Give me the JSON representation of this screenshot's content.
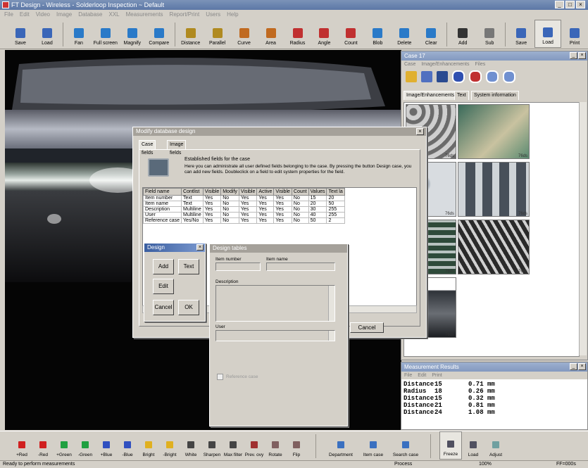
{
  "app": {
    "title": "FT Design - Wireless - Solderloop Inspection ~ Default",
    "menu": [
      "File",
      "Edit",
      "Video",
      "Image",
      "Database",
      "XXL",
      "Measurements",
      "Report/Print",
      "Users",
      "Help"
    ]
  },
  "toolbar": {
    "groups": [
      [
        {
          "label": "Save",
          "color": "#3a66b8"
        },
        {
          "label": "Load",
          "color": "#3a66b8"
        }
      ],
      [
        {
          "label": "Fan",
          "color": "#2a7ac8"
        },
        {
          "label": "Full screen",
          "color": "#2a7ac8"
        },
        {
          "label": "Magnify",
          "color": "#2a7ac8"
        },
        {
          "label": "Compare",
          "color": "#2a7ac8"
        }
      ],
      [
        {
          "label": "Distance",
          "color": "#b08a20"
        },
        {
          "label": "Parallel",
          "color": "#b08a20"
        },
        {
          "label": "Curve",
          "color": "#c06a20"
        },
        {
          "label": "Area",
          "color": "#c06a20"
        },
        {
          "label": "Radius",
          "color": "#c03030"
        },
        {
          "label": "Angle",
          "color": "#c03030"
        },
        {
          "label": "Count",
          "color": "#c03030"
        },
        {
          "label": "Blob",
          "color": "#2a7ac8"
        },
        {
          "label": "Delete",
          "color": "#2a7ac8"
        },
        {
          "label": "Clear",
          "color": "#2a7ac8"
        }
      ],
      [
        {
          "label": "Add",
          "color": "#333333"
        },
        {
          "label": "Sub",
          "color": "#777777"
        }
      ],
      [
        {
          "label": "Save",
          "color": "#3a66b8"
        },
        {
          "label": "Load",
          "color": "#3a66b8",
          "active": true
        },
        {
          "label": "Print",
          "color": "#3a66b8"
        }
      ]
    ]
  },
  "case_panel": {
    "title": "Case 17",
    "menu": [
      "Case",
      "Image/Enhancements",
      "Files"
    ],
    "tabs": [
      "Image/Enhancements",
      "Text",
      "System information"
    ],
    "thumb_caption": "76ds"
  },
  "results_panel": {
    "title": "Measurement Results",
    "menu": [
      "File",
      "Edit",
      "Print"
    ],
    "rows": [
      {
        "name": "Distance",
        "id": "15",
        "value": "0.71 mm"
      },
      {
        "name": "Radius",
        "id": "18",
        "value": "0.26 mm"
      },
      {
        "name": "Distance",
        "id": "15",
        "value": "0.32 mm"
      },
      {
        "name": "Distance",
        "id": "21",
        "value": "0.81 mm"
      },
      {
        "name": "Distance",
        "id": "24",
        "value": "1.08 mm"
      }
    ]
  },
  "dialog_design": {
    "title": "Modify database design",
    "tabs": [
      "Case fields",
      "Image fields"
    ],
    "info_title": "Established fields for the case",
    "info_text": "Here you can administrate all user defined fields belonging to the case. By pressing the button Design case, you can add new fields. Doubleclick on a field to edit system properties for the field.",
    "table": {
      "headers": [
        "Field name",
        "Contlist",
        "Visible",
        "Modify",
        "Visible",
        "Active",
        "Visible",
        "Count",
        "Values",
        "Text la"
      ],
      "rows": [
        [
          "Item number",
          "Text",
          "Yes",
          "No",
          "Yes",
          "Yes",
          "Yes",
          "No",
          "15",
          "20"
        ],
        [
          "Item name",
          "Text",
          "Yes",
          "No",
          "Yes",
          "Yes",
          "Yes",
          "No",
          "20",
          "50"
        ],
        [
          "Description",
          "Multiline",
          "Yes",
          "No",
          "Yes",
          "Yes",
          "Yes",
          "No",
          "30",
          "255"
        ],
        [
          "User",
          "Multiline",
          "Yes",
          "No",
          "Yes",
          "Yes",
          "Yes",
          "No",
          "40",
          "255"
        ],
        [
          "Reference case",
          "Yes/No",
          "Yes",
          "No",
          "Yes",
          "Yes",
          "Yes",
          "No",
          "50",
          "2"
        ]
      ]
    },
    "cancel_label": "Cancel"
  },
  "dialog_small": {
    "title": "Design",
    "buttons": [
      "Add",
      "Text",
      "Edit",
      "Cancel",
      "OK"
    ]
  },
  "dialog_edit": {
    "title": "Design tables",
    "item_number_label": "Item number",
    "item_name_label": "Item name",
    "description_label": "Description",
    "user_label": "User",
    "checkbox_label": "Reference case"
  },
  "bottom_toolbar": {
    "buttons": [
      {
        "label": "+Red",
        "color": "#d02020"
      },
      {
        "label": "-Red",
        "color": "#d02020"
      },
      {
        "label": "+Green",
        "color": "#20a040"
      },
      {
        "label": "-Green",
        "color": "#20a040"
      },
      {
        "label": "+Blue",
        "color": "#3050c0"
      },
      {
        "label": "-Blue",
        "color": "#3050c0"
      },
      {
        "label": "Bright",
        "color": "#e0b020"
      },
      {
        "label": "-Bright",
        "color": "#e0b020"
      },
      {
        "label": "White",
        "color": "#444444"
      },
      {
        "label": "Sharpen",
        "color": "#444444"
      },
      {
        "label": "Max filter",
        "color": "#444444"
      },
      {
        "label": "Prev. ovy",
        "color": "#a03030"
      },
      {
        "label": "Rotate",
        "color": "#806060"
      },
      {
        "label": "Flip",
        "color": "#806060"
      }
    ],
    "buttons2": [
      {
        "label": "Department",
        "color": "#3a70c0"
      },
      {
        "label": "Item case",
        "color": "#3a70c0"
      },
      {
        "label": "Search case",
        "color": "#3a70c0"
      }
    ],
    "buttons3": [
      {
        "label": "Freeze",
        "color": "#505060",
        "active": true
      },
      {
        "label": "Load",
        "color": "#505060"
      },
      {
        "label": "Adjust",
        "color": "#70a0a0"
      }
    ]
  },
  "statusbar": {
    "left": "Ready to perform measurements",
    "mid": "Process",
    "zoom": "100%",
    "right": "FF=000s"
  }
}
